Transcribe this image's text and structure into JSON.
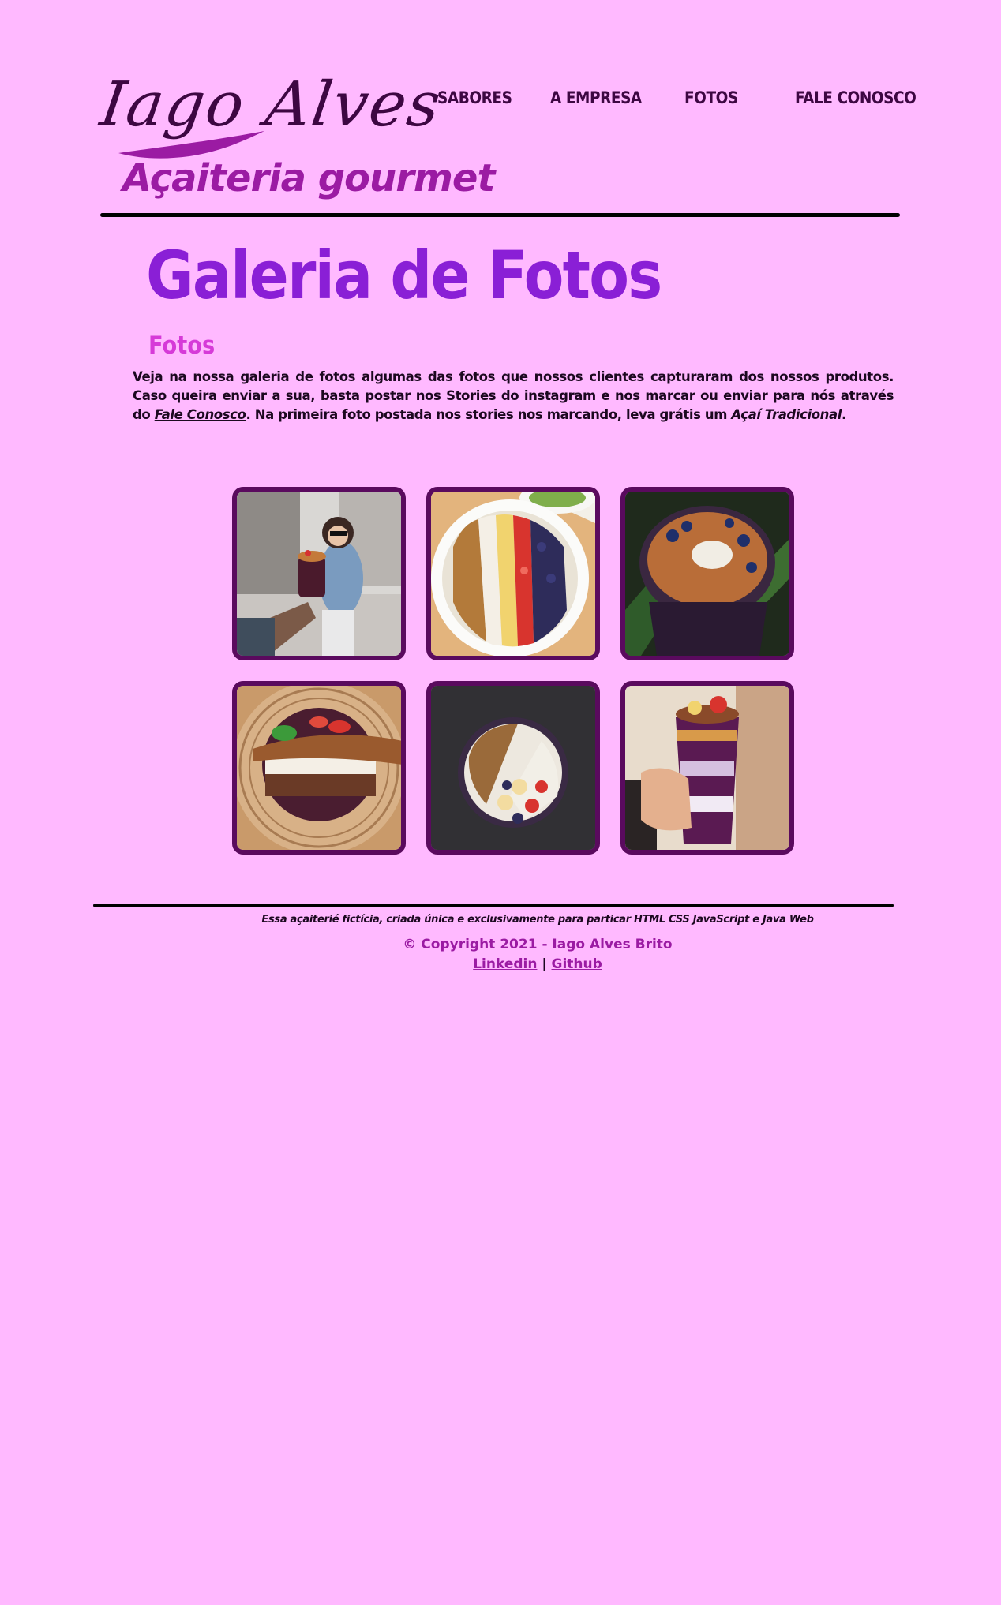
{
  "brand": {
    "logo_script": "Iago Alves",
    "logo_subtitle": "Açaiteria gourmet"
  },
  "nav": {
    "items": [
      "SABORES",
      "A EMPRESA",
      "FOTOS",
      "FALE CONOSCO"
    ]
  },
  "main": {
    "page_title": "Galeria de Fotos",
    "section_title": "Fotos",
    "intro_part1": "Veja na nossa galeria de fotos algumas das fotos que nossos clientes capturaram dos nossos produtos. Caso queira enviar a sua, basta postar nos Stories do instagram e nos marcar ou enviar para nós através do ",
    "intro_link": "Fale Conosco",
    "intro_part2": ". Na primeira foto postada nos stories nos marcando, leva grátis um ",
    "intro_emphasis": "Açaí Tradicional",
    "intro_part3": "."
  },
  "gallery": {
    "photos": [
      {
        "subject": "woman-holding-acai-cup-photo"
      },
      {
        "subject": "acai-bowl-granola-strawberry-banana-photo"
      },
      {
        "subject": "acai-cup-peanut-coconut-blueberry-photo"
      },
      {
        "subject": "acai-bowl-wooden-spoon-photo"
      },
      {
        "subject": "acai-bowl-dark-background-photo"
      },
      {
        "subject": "hand-holding-layered-acai-cup-photo"
      }
    ]
  },
  "footer": {
    "note": "Essa açaiterié fictícia, criada única e exclusivamente para particar HTML CSS JavaScript e Java Web",
    "copyright": "© Copyright 2021 - Iago Alves Brito",
    "linkedin": "Linkedin",
    "separator": "|",
    "github": "Github"
  },
  "colors": {
    "background": "#ffb9ff",
    "dark_purple": "#3d0742",
    "title_purple": "#8a1fd6",
    "section_pink": "#d63ad8",
    "accent_magenta": "#9b1ba3",
    "photo_border": "#5a0a5e"
  }
}
